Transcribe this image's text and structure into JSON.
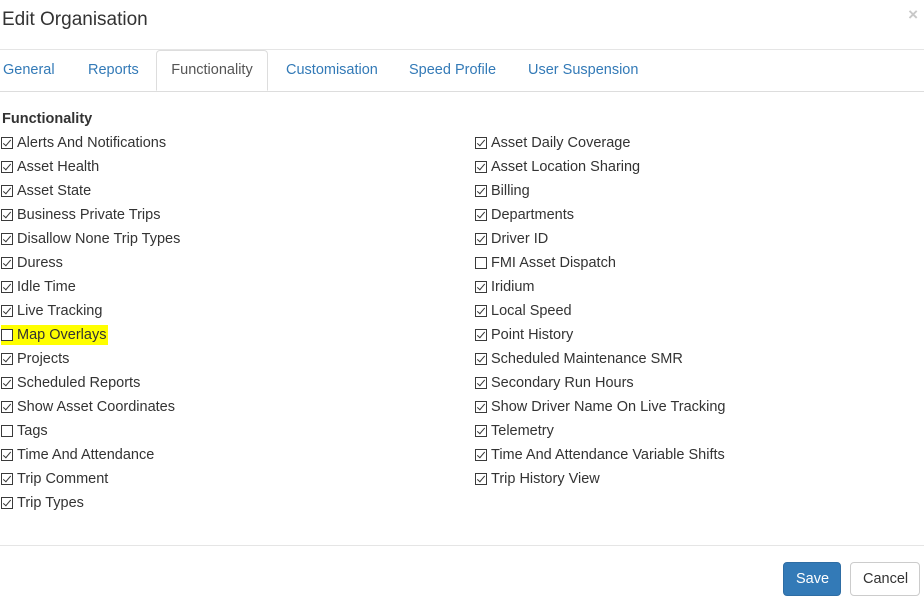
{
  "header": {
    "title": "Edit Organisation",
    "close_glyph": "×"
  },
  "tabs": [
    {
      "label": "General",
      "active": false
    },
    {
      "label": "Reports",
      "active": false
    },
    {
      "label": "Functionality",
      "active": true
    },
    {
      "label": "Customisation",
      "active": false
    },
    {
      "label": "Speed Profile",
      "active": false
    },
    {
      "label": "User Suspension",
      "active": false
    }
  ],
  "section": {
    "title": "Functionality"
  },
  "left_items": [
    {
      "label": "Alerts And Notifications",
      "checked": true
    },
    {
      "label": "Asset Health",
      "checked": true
    },
    {
      "label": "Asset State",
      "checked": true
    },
    {
      "label": "Business Private Trips",
      "checked": true
    },
    {
      "label": "Disallow None Trip Types",
      "checked": true
    },
    {
      "label": "Duress",
      "checked": true
    },
    {
      "label": "Idle Time",
      "checked": true
    },
    {
      "label": "Live Tracking",
      "checked": true
    },
    {
      "label": "Map Overlays",
      "checked": false,
      "highlighted": true
    },
    {
      "label": "Projects",
      "checked": true
    },
    {
      "label": "Scheduled Reports",
      "checked": true
    },
    {
      "label": "Show Asset Coordinates",
      "checked": true
    },
    {
      "label": "Tags",
      "checked": false
    },
    {
      "label": "Time And Attendance",
      "checked": true
    },
    {
      "label": "Trip Comment",
      "checked": true
    },
    {
      "label": "Trip Types",
      "checked": true
    }
  ],
  "right_items": [
    {
      "label": "Asset Daily Coverage",
      "checked": true
    },
    {
      "label": "Asset Location Sharing",
      "checked": true
    },
    {
      "label": "Billing",
      "checked": true
    },
    {
      "label": "Departments",
      "checked": true
    },
    {
      "label": "Driver ID",
      "checked": true
    },
    {
      "label": "FMI Asset Dispatch",
      "checked": false
    },
    {
      "label": "Iridium",
      "checked": true
    },
    {
      "label": "Local Speed",
      "checked": true
    },
    {
      "label": "Point History",
      "checked": true
    },
    {
      "label": "Scheduled Maintenance SMR",
      "checked": true
    },
    {
      "label": "Secondary Run Hours",
      "checked": true
    },
    {
      "label": "Show Driver Name On Live Tracking",
      "checked": true
    },
    {
      "label": "Telemetry",
      "checked": true
    },
    {
      "label": "Time And Attendance Variable Shifts",
      "checked": true
    },
    {
      "label": "Trip History View",
      "checked": true
    }
  ],
  "footer": {
    "save_label": "Save",
    "cancel_label": "Cancel"
  },
  "colors": {
    "link": "#337ab7",
    "primary": "#337ab7",
    "highlight": "#ffff00"
  }
}
